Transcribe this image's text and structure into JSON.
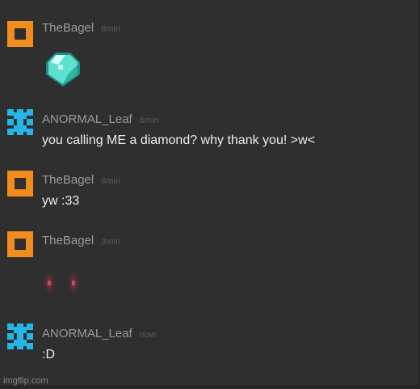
{
  "messages": [
    {
      "username": "TheBagel",
      "time": "8min",
      "avatar": "orange-square-avatar",
      "content": "diamond-emoji"
    },
    {
      "username": "ANORMAL_Leaf",
      "time": "6min",
      "avatar": "blue-pixel-avatar",
      "text": "you calling ME a diamond? why thank you! >w<"
    },
    {
      "username": "TheBagel",
      "time": "6min",
      "avatar": "orange-square-avatar",
      "text": "yw :33"
    },
    {
      "username": "TheBagel",
      "time": "3min",
      "avatar": "orange-square-avatar",
      "content": "blush-emoji"
    },
    {
      "username": "ANORMAL_Leaf",
      "time": "now",
      "avatar": "blue-pixel-avatar",
      "text": ":D"
    }
  ],
  "colors": {
    "orange": "#f28c1c",
    "blue": "#23b6e6",
    "diamond": "#5fe0cf"
  },
  "watermark": "imgflip.com"
}
